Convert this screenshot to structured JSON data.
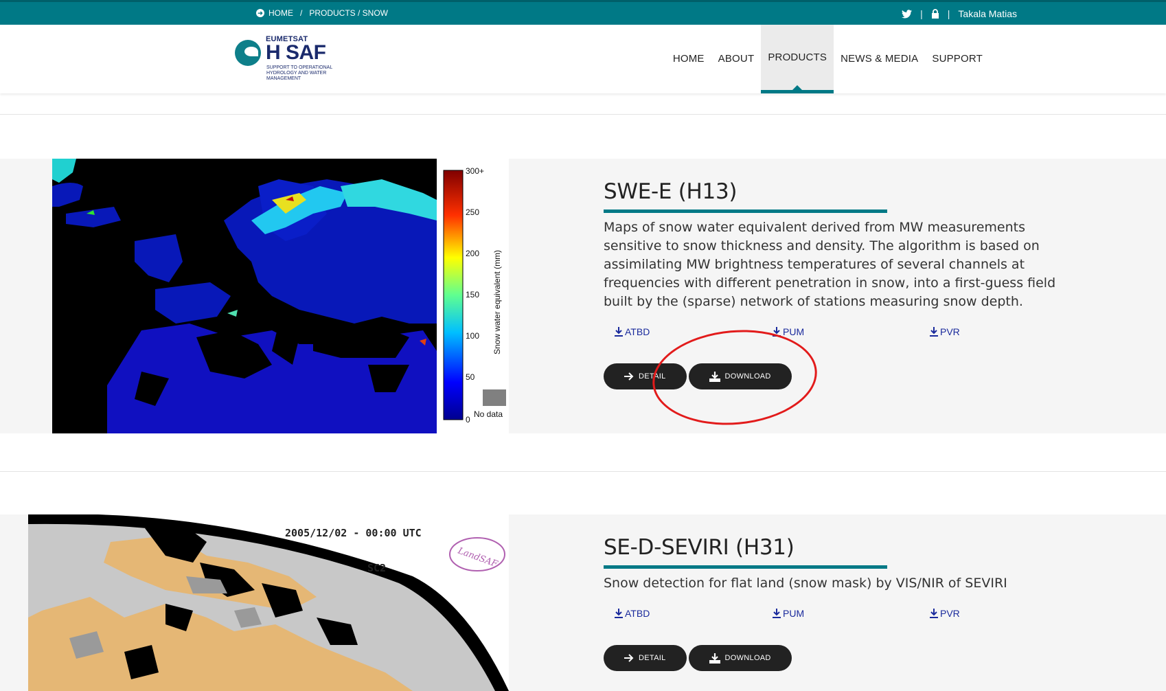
{
  "topbar": {
    "crumbs": [
      "HOME",
      "/",
      "PRODUCTS / SNOW"
    ],
    "user": "Takala Matias",
    "separators": [
      "|",
      "|"
    ]
  },
  "logo": {
    "eumetsat": "EUMETSAT",
    "name": "H SAF",
    "tagline": "SUPPORT TO OPERATIONAL HYDROLOGY AND WATER MANAGEMENT"
  },
  "nav": {
    "items": [
      "HOME",
      "ABOUT",
      "PRODUCTS",
      "NEWS & MEDIA",
      "SUPPORT"
    ],
    "active": "PRODUCTS"
  },
  "products": [
    {
      "title": "SWE-E (H13)",
      "description": "Maps of snow water equivalent derived from MW measurements sensitive to snow thickness and density. The algorithm is based on assimilating MW brightness temperatures of several channels at frequencies with different penetration in snow, into a first-guess field built by the (sparse) network of stations measuring snow depth.",
      "docs": [
        "ATBD",
        "PUM",
        "PVR"
      ],
      "detail_label": "DETAIL",
      "download_label": "DOWNLOAD",
      "image": {
        "colorbar_label": "Snow water equivalent (mm)",
        "ticks": [
          "300+",
          "250",
          "200",
          "150",
          "100",
          "50",
          "0"
        ],
        "nodata_label": "No data"
      }
    },
    {
      "title": "SE-D-SEVIRI (H31)",
      "description": "Snow detection for flat land (snow mask) by VIS/NIR of SEVIRI",
      "docs": [
        "ATBD",
        "PUM",
        "PVR"
      ],
      "detail_label": "DETAIL",
      "download_label": "DOWNLOAD",
      "image": {
        "timestamp": "2005/12/02 - 00:00 UTC",
        "code": "SC2",
        "logo_text": "LandSAF"
      }
    }
  ],
  "colors": {
    "teal": "#007986",
    "navy": "#1a2a6c",
    "button": "#222222",
    "annotation": "#e21b1b"
  }
}
